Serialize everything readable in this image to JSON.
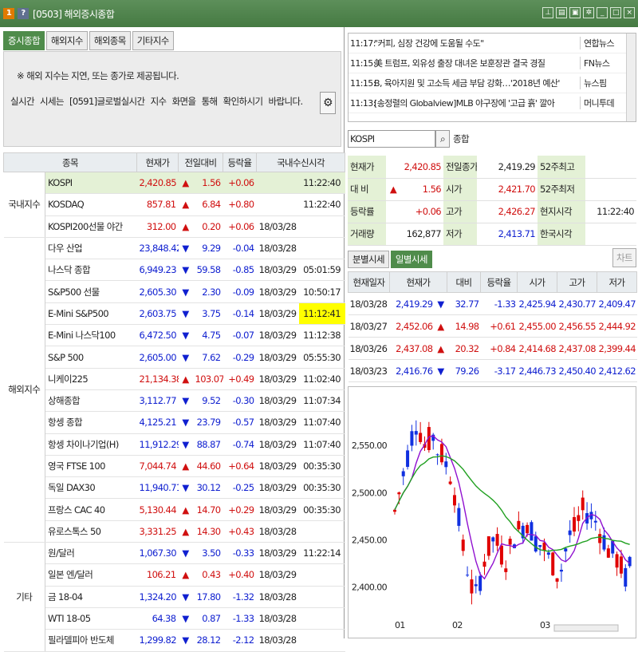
{
  "window": {
    "badge1": "1",
    "badge2": "?",
    "title": "[0503] 해외증시종합"
  },
  "tabs": [
    "증시종합",
    "해외지수",
    "해외종목",
    "기타지수"
  ],
  "notice": {
    "line1": "※ 해외 지수는 지연, 또는 종가로 제공됩니다.",
    "line2": "실시간 시세는 [0591]글로벌실시간 지수 화면을 통해 확인하시기 바랍니다."
  },
  "grid": {
    "headers": [
      "종목",
      "현재가",
      "전일대비",
      "등락율",
      "국내수신시각"
    ],
    "groups": {
      "domestic": "국내지수",
      "overseas": "해외지수",
      "other": "기타"
    },
    "rows": [
      {
        "name": "KOSPI",
        "price": "2,420.85",
        "dir": "up",
        "change": "1.56",
        "rate": "+0.06",
        "date": "",
        "time": "11:22:40"
      },
      {
        "name": "KOSDAQ",
        "price": "857.81",
        "dir": "up",
        "change": "6.84",
        "rate": "+0.80",
        "date": "",
        "time": "11:22:40"
      },
      {
        "name": "KOSPI200선물 야간",
        "price": "312.00",
        "dir": "up",
        "change": "0.20",
        "rate": "+0.06",
        "date": "18/03/28",
        "time": ""
      },
      {
        "name": "다우 산업",
        "price": "23,848.42",
        "dir": "dn",
        "change": "9.29",
        "rate": "-0.04",
        "date": "18/03/28",
        "time": ""
      },
      {
        "name": "나스닥 종합",
        "price": "6,949.23",
        "dir": "dn",
        "change": "59.58",
        "rate": "-0.85",
        "date": "18/03/29",
        "time": "05:01:59"
      },
      {
        "name": "S&P500 선물",
        "price": "2,605.30",
        "dir": "dn",
        "change": "2.30",
        "rate": "-0.09",
        "date": "18/03/29",
        "time": "10:50:17"
      },
      {
        "name": "E-Mini S&P500",
        "price": "2,603.75",
        "dir": "dn",
        "change": "3.75",
        "rate": "-0.14",
        "date": "18/03/29",
        "time": "11:12:41"
      },
      {
        "name": "E-Mini 나스닥100",
        "price": "6,472.50",
        "dir": "dn",
        "change": "4.75",
        "rate": "-0.07",
        "date": "18/03/29",
        "time": "11:12:38"
      },
      {
        "name": "S&P 500",
        "price": "2,605.00",
        "dir": "dn",
        "change": "7.62",
        "rate": "-0.29",
        "date": "18/03/29",
        "time": "05:55:30"
      },
      {
        "name": "니케이225",
        "price": "21,134.38",
        "dir": "up",
        "change": "103.07",
        "rate": "+0.49",
        "date": "18/03/29",
        "time": "11:02:40"
      },
      {
        "name": "상해종합",
        "price": "3,112.77",
        "dir": "dn",
        "change": "9.52",
        "rate": "-0.30",
        "date": "18/03/29",
        "time": "11:07:34"
      },
      {
        "name": "항셍 종합",
        "price": "4,125.21",
        "dir": "dn",
        "change": "23.79",
        "rate": "-0.57",
        "date": "18/03/29",
        "time": "11:07:40"
      },
      {
        "name": "항셍 차이나기업(H)",
        "price": "11,912.29",
        "dir": "dn",
        "change": "88.87",
        "rate": "-0.74",
        "date": "18/03/29",
        "time": "11:07:40"
      },
      {
        "name": "영국 FTSE 100",
        "price": "7,044.74",
        "dir": "up",
        "change": "44.60",
        "rate": "+0.64",
        "date": "18/03/29",
        "time": "00:35:30"
      },
      {
        "name": "독일 DAX30",
        "price": "11,940.71",
        "dir": "dn",
        "change": "30.12",
        "rate": "-0.25",
        "date": "18/03/29",
        "time": "00:35:30"
      },
      {
        "name": "프랑스 CAC 40",
        "price": "5,130.44",
        "dir": "up",
        "change": "14.70",
        "rate": "+0.29",
        "date": "18/03/29",
        "time": "00:35:30"
      },
      {
        "name": "유로스톡스 50",
        "price": "3,331.25",
        "dir": "up",
        "change": "14.30",
        "rate": "+0.43",
        "date": "18/03/28",
        "time": ""
      },
      {
        "name": "원/달러",
        "price": "1,067.30",
        "dir": "dn",
        "change": "3.50",
        "rate": "-0.33",
        "date": "18/03/29",
        "time": "11:22:14"
      },
      {
        "name": "일본 엔/달러",
        "price": "106.21",
        "dir": "up",
        "change": "0.43",
        "rate": "+0.40",
        "date": "18/03/29",
        "time": ""
      },
      {
        "name": "금 18-04",
        "price": "1,324.20",
        "dir": "dn",
        "change": "17.80",
        "rate": "-1.32",
        "date": "18/03/28",
        "time": ""
      },
      {
        "name": "WTI 18-05",
        "price": "64.38",
        "dir": "dn",
        "change": "0.87",
        "rate": "-1.33",
        "date": "18/03/28",
        "time": ""
      },
      {
        "name": "필라델피아 반도체",
        "price": "1,299.82",
        "dir": "dn",
        "change": "28.12",
        "rate": "-2.12",
        "date": "18/03/28",
        "time": ""
      }
    ]
  },
  "news": [
    {
      "time": "11:17:",
      "headline": "\"커피, 심장 건강에 도움될 수도\"",
      "source": "연합뉴스"
    },
    {
      "time": "11:15:",
      "headline": "美 트럼프, 외유성 출장 대녀온 보훈장관 결국 경질",
      "source": "FN뉴스"
    },
    {
      "time": "11:15:",
      "headline": "B, 육아지원 및 고소득 세금 부담 강화…'2018년 예산'",
      "source": "뉴스핌"
    },
    {
      "time": "11:13:",
      "headline": "[송정렬의 Globalview]MLB 야구장에 '고급 흙' 깔아",
      "source": "머니투데"
    }
  ],
  "search": {
    "value": "KOSPI",
    "name": "종합"
  },
  "quote": {
    "rows": [
      [
        "현재가",
        "2,420.85",
        "",
        "전일종가",
        "2,419.29",
        "52주최고",
        ""
      ],
      [
        "대 비",
        "▲",
        "1.56",
        "시가",
        "2,421.70",
        "52주최저",
        ""
      ],
      [
        "등락률",
        "+0.06",
        "",
        "고가",
        "2,426.27",
        "현지시각",
        "11:22:40"
      ],
      [
        "거래량",
        "162,877",
        "",
        "저가",
        "2,413.71",
        "한국시각",
        ""
      ]
    ]
  },
  "subtabs": [
    "분별시세",
    "일별시세"
  ],
  "chart_button": "차트",
  "daily": {
    "headers": [
      "현재일자",
      "현재가",
      "",
      "대비",
      "등락율",
      "시가",
      "고가",
      "저가"
    ],
    "rows": [
      {
        "date": "18/03/28",
        "price": "2,419.29",
        "dir": "dn",
        "change": "32.77",
        "rate": "-1.33",
        "open": "2,425.94",
        "high": "2,430.77",
        "low": "2,409.47"
      },
      {
        "date": "18/03/27",
        "price": "2,452.06",
        "dir": "up",
        "change": "14.98",
        "rate": "+0.61",
        "open": "2,455.00",
        "high": "2,456.55",
        "low": "2,444.92"
      },
      {
        "date": "18/03/26",
        "price": "2,437.08",
        "dir": "up",
        "change": "20.32",
        "rate": "+0.84",
        "open": "2,414.68",
        "high": "2,437.08",
        "low": "2,399.44"
      },
      {
        "date": "18/03/23",
        "price": "2,416.76",
        "dir": "dn",
        "change": "79.26",
        "rate": "-3.17",
        "open": "2,446.73",
        "high": "2,450.40",
        "low": "2,412.62"
      }
    ]
  },
  "chart_data": {
    "type": "candlestick",
    "yticks": [
      "2,550.00",
      "2,500.00",
      "2,450.00",
      "2,400.00"
    ],
    "ytick_values": [
      2550,
      2500,
      2450,
      2400
    ],
    "xticks": [
      "01",
      "02",
      "03"
    ],
    "ylim": [
      2375,
      2595
    ],
    "colors": {
      "up": "#e00000",
      "down": "#1030e0",
      "ma_short": "#9010d0",
      "ma_long": "#20a020"
    }
  }
}
